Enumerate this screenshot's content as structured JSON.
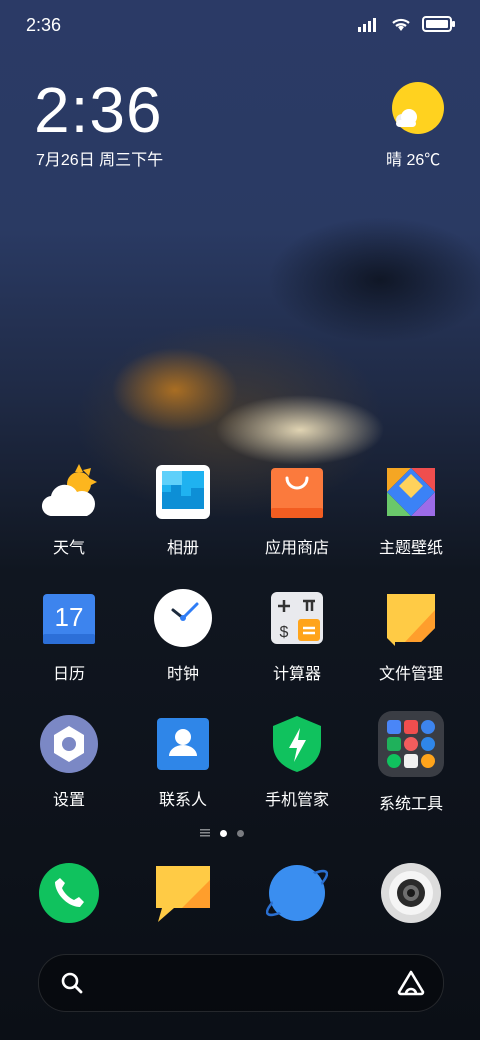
{
  "status_bar": {
    "time": "2:36"
  },
  "lockscreen": {
    "clock": "2:36",
    "date": "7月26日 周三下午",
    "weather": "晴 26℃"
  },
  "apps": [
    {
      "label": "天气"
    },
    {
      "label": "相册"
    },
    {
      "label": "应用商店"
    },
    {
      "label": "主题壁纸"
    },
    {
      "label": "日历"
    },
    {
      "label": "时钟"
    },
    {
      "label": "计算器"
    },
    {
      "label": "文件管理"
    },
    {
      "label": "设置"
    },
    {
      "label": "联系人"
    },
    {
      "label": "手机管家"
    },
    {
      "label": "系统工具"
    }
  ],
  "calendar_icon_day": "17",
  "dock": [
    "phone-icon",
    "messages-icon",
    "browser-icon",
    "camera-icon"
  ],
  "page_indicator": {
    "pages": 2,
    "current": 1
  },
  "colors": {
    "accent_green": "#10c25e",
    "accent_blue": "#3a8ef0",
    "accent_orange": "#fb7a3d",
    "note_yellow": "#ffc83d"
  }
}
